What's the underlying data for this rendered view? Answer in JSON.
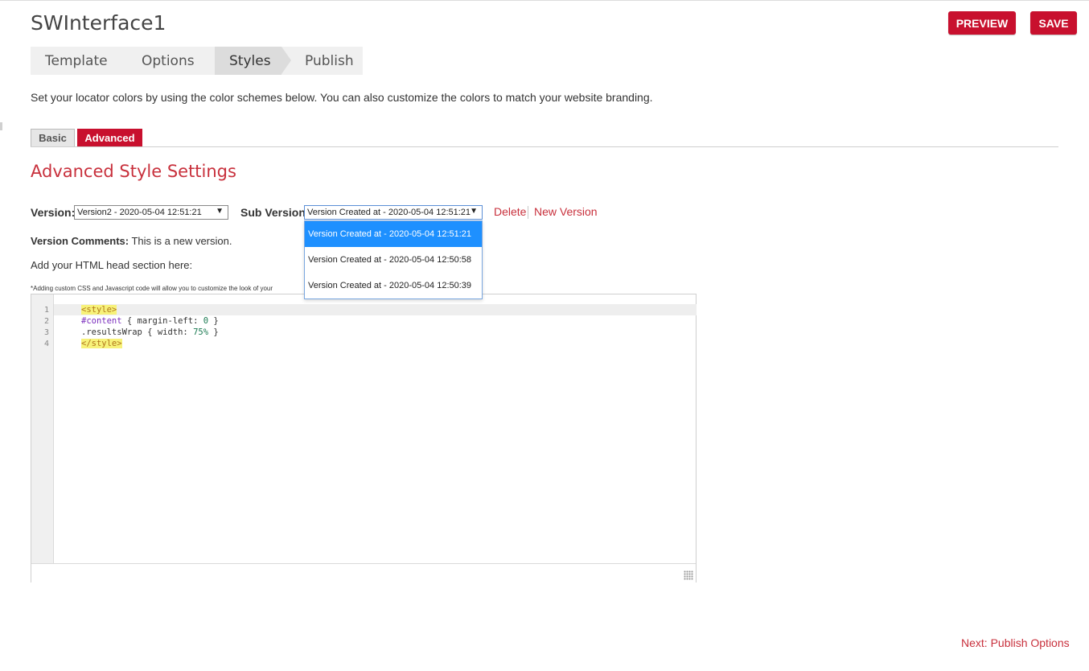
{
  "header": {
    "title": "SWInterface1",
    "preview_label": "PREVIEW",
    "save_label": "SAVE"
  },
  "wizard": {
    "steps": [
      "Template",
      "Options",
      "Styles",
      "Publish"
    ],
    "active": "Styles"
  },
  "intro_text": "Set your locator colors by using the color schemes below. You can also customize the colors to match your website branding.",
  "tabs": {
    "basic": "Basic",
    "advanced": "Advanced",
    "active": "Advanced"
  },
  "section_title": "Advanced Style Settings",
  "version": {
    "label": "Version:",
    "value": "Version2 - 2020-05-04 12:51:21"
  },
  "sub_version": {
    "label": "Sub Version:",
    "value": "Version Created at - 2020-05-04 12:51:21",
    "options": [
      "Version Created at - 2020-05-04 12:51:21",
      "Version Created at - 2020-05-04 12:50:58",
      "Version Created at - 2020-05-04 12:50:39"
    ],
    "highlighted_option": 0
  },
  "actions": {
    "delete_label": "Delete",
    "new_version_label": "New Version"
  },
  "comments": {
    "label": "Version Comments:",
    "text": "This is a new version."
  },
  "head_section_label": "Add your HTML head section here:",
  "custom_note": "*Adding custom CSS and Javascript code will allow you to customize the look of your",
  "editor": {
    "line_numbers": [
      "1",
      "2",
      "3",
      "4"
    ],
    "lines": {
      "l1": "<style>",
      "l2_selector": "#content",
      "l2_rest": " { margin-left: ",
      "l2_num": "0",
      "l2_end": " }",
      "l3_selector": ".resultsWrap",
      "l3_rest": " { width: ",
      "l3_num": "75%",
      "l3_end": " }",
      "l4": "</style>"
    }
  },
  "next_link": "Next: Publish Options",
  "colors": {
    "accent": "#c8102e",
    "link": "#c8303c",
    "selected_option": "#1e90ff"
  }
}
